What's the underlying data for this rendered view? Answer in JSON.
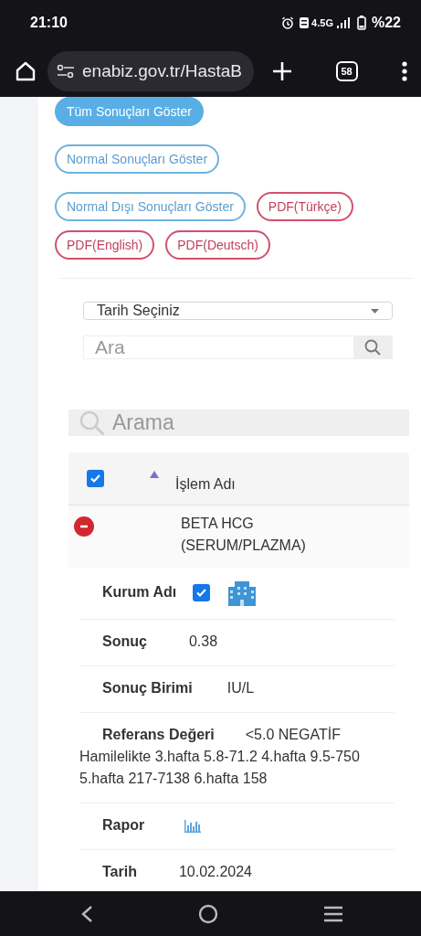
{
  "status_bar": {
    "time": "21:10",
    "network": "4.5G",
    "battery": "%22"
  },
  "browser": {
    "url": "enabiz.gov.tr/HastaB",
    "tab_count": "58"
  },
  "filter_buttons": [
    {
      "label": "Tüm Sonuçları Göster",
      "kind": "filter",
      "selected": true
    },
    {
      "label": "Normal Sonuçları Göster",
      "kind": "filter",
      "selected": false
    },
    {
      "label": "Normal Dışı Sonuçları Göster",
      "kind": "filter",
      "selected": false
    },
    {
      "label": "PDF(Türkçe)",
      "kind": "pdf",
      "selected": false
    },
    {
      "label": "PDF(English)",
      "kind": "pdf",
      "selected": false
    },
    {
      "label": "PDF(Deutsch)",
      "kind": "pdf",
      "selected": false
    }
  ],
  "date_select": {
    "value": "Tarih Seçiniz"
  },
  "search": {
    "placeholder": "Ara"
  },
  "table_search": {
    "placeholder": "Arama"
  },
  "table": {
    "header": {
      "checked": true,
      "sort_ascending": true,
      "column": "İşlem Adı"
    },
    "row": {
      "expanded": true,
      "name": "BETA HCG (SERUM/PLAZMA)"
    },
    "details": [
      {
        "kind": "institution",
        "label": "Kurum Adı",
        "checked": true
      },
      {
        "kind": "text",
        "label": "Sonuç",
        "value": "0.38"
      },
      {
        "kind": "text",
        "label": "Sonuç Birimi",
        "value": "IU/L"
      },
      {
        "kind": "text",
        "label": "Referans Değeri",
        "value": "<5.0 NEGATİF Hamilelikte 3.hafta 5.8-71.2 4.hafta 9.5-750 5.hafta 217-7138 6.hafta 158"
      },
      {
        "kind": "report",
        "label": "Rapor"
      },
      {
        "kind": "text",
        "label": "Tarih",
        "value": "10.02.2024"
      }
    ]
  }
}
